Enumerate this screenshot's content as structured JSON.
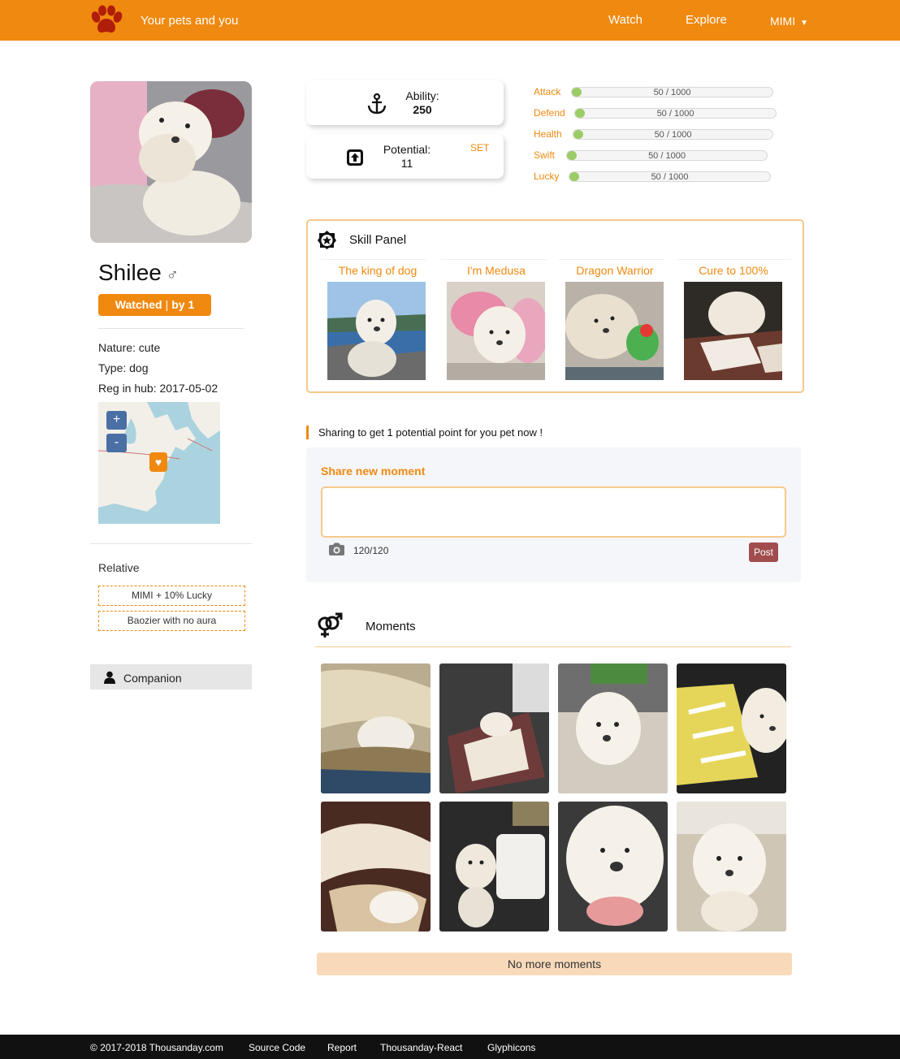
{
  "nav": {
    "brand": "Your pets and you",
    "links": [
      "Watch",
      "Explore"
    ],
    "user": "MIMI"
  },
  "pet": {
    "name": "Shilee",
    "gender_symbol": "♂",
    "watch_label": "Watched",
    "watch_sep": "|",
    "watch_count": "by 1",
    "nature": "Nature: cute",
    "type": "Type: dog",
    "reg": "Reg in hub: 2017-05-02"
  },
  "map": {
    "zoom_in": "+",
    "zoom_out": "-"
  },
  "relative": {
    "title": "Relative",
    "items": [
      "MIMI + 10% Lucky",
      "Baozier with no aura"
    ]
  },
  "companion": {
    "label": "Companion"
  },
  "cards": {
    "ability_label": "Ability:",
    "ability_value": "250",
    "potential_label": "Potential:",
    "potential_value": "11",
    "set_label": "SET"
  },
  "stats": [
    {
      "name": "Attack",
      "text": "50 / 1000",
      "fraction": 0.05
    },
    {
      "name": "Defend",
      "text": "50 / 1000",
      "fraction": 0.05
    },
    {
      "name": "Health",
      "text": "50 / 1000",
      "fraction": 0.05
    },
    {
      "name": "Swift",
      "text": "50 / 1000",
      "fraction": 0.05
    },
    {
      "name": "Lucky",
      "text": "50 / 1000",
      "fraction": 0.05
    }
  ],
  "skill_panel": {
    "title": "Skill Panel",
    "skills": [
      "The king of dog",
      "I'm Medusa",
      "Dragon Warrior",
      "Cure to 100%"
    ]
  },
  "share": {
    "hint": "Sharing to get 1 potential point for you pet now !",
    "title": "Share new moment",
    "placeholder": "",
    "count": "120/120",
    "post_label": "Post"
  },
  "moments": {
    "title": "Moments",
    "no_more": "No more moments"
  },
  "footer": {
    "copyright": "© 2017-2018 Thousanday.com",
    "links": [
      "Source Code",
      "Report",
      "Thousanday-React",
      "Glyphicons"
    ]
  },
  "colors": {
    "brand": "#f0890f",
    "stat_fill": "#9ccc65",
    "post_button": "#a14d4d",
    "paw": "#b01e0a"
  }
}
